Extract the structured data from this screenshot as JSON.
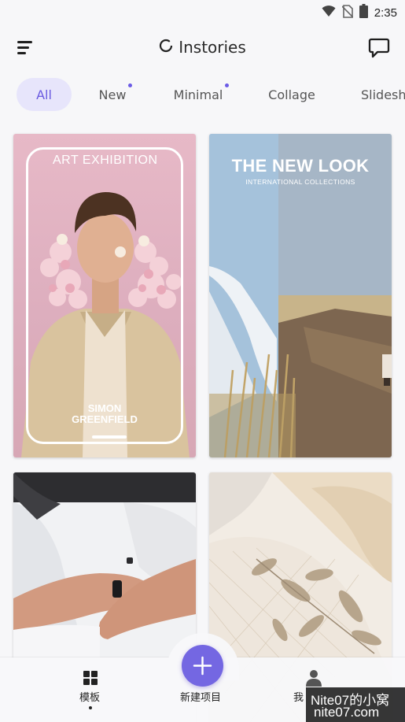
{
  "status_bar": {
    "time": "2:35",
    "icons": [
      "wifi-icon",
      "no-sim-icon",
      "battery-icon"
    ]
  },
  "header": {
    "title": "Instories",
    "menu_icon": "menu-icon",
    "logo_icon": "ring-logo-icon",
    "chat_icon": "chat-bubble-icon"
  },
  "tabs": [
    {
      "label": "All",
      "active": true,
      "dot": false
    },
    {
      "label": "New",
      "active": false,
      "dot": true
    },
    {
      "label": "Minimal",
      "active": false,
      "dot": true
    },
    {
      "label": "Collage",
      "active": false,
      "dot": false
    },
    {
      "label": "Slidesh",
      "active": false,
      "dot": false
    }
  ],
  "templates": [
    {
      "heading": "ART EXHIBITION",
      "name_line1": "SIMON",
      "name_line2": "GREENFIELD"
    },
    {
      "heading": "THE NEW LOOK",
      "subheading": "INTERNATIONAL COLLECTIONS"
    },
    {
      "heading": ""
    },
    {
      "heading": ""
    }
  ],
  "bottom_nav": {
    "templates_label": "模板",
    "create_label": "新建项目",
    "profile_label": "我",
    "templates_icon": "grid-icon",
    "create_icon": "plus-icon",
    "profile_icon": "person-icon"
  },
  "watermark": {
    "line1": "Nite07的小窝",
    "line2": "nite07.com"
  },
  "colors": {
    "accent": "#7467e2",
    "tab_active_bg": "#e7e5fb",
    "background": "#f7f7f9"
  }
}
